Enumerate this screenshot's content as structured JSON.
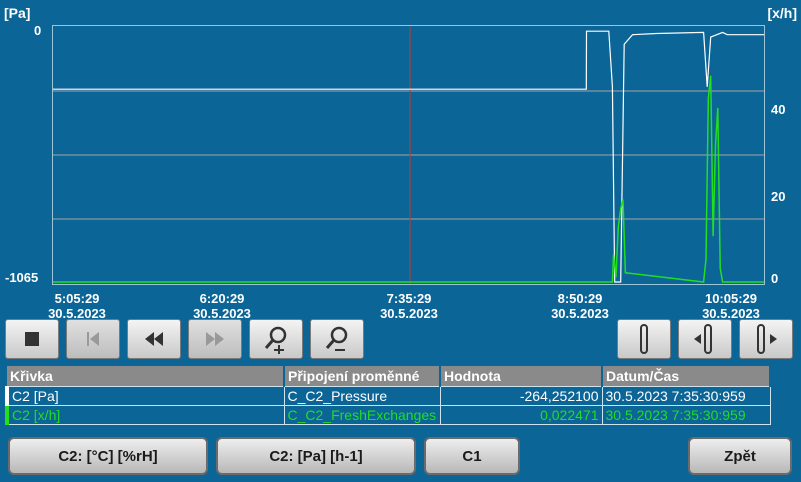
{
  "units": {
    "left": "[Pa]",
    "right": "[x/h]"
  },
  "y_left_ticks": [
    "0",
    "-1065"
  ],
  "y_right_ticks": [
    "40",
    "20",
    "0"
  ],
  "x_ticks": [
    {
      "time": "5:05:29",
      "date": "30.5.2023"
    },
    {
      "time": "6:20:29",
      "date": "30.5.2023"
    },
    {
      "time": "7:35:29",
      "date": "30.5.2023"
    },
    {
      "time": "8:50:29",
      "date": "30.5.2023"
    },
    {
      "time": "10:05:29",
      "date": "30.5.2023"
    }
  ],
  "colors": {
    "background": "#0b6597",
    "pressure_series": "#ffffff",
    "exchange_series": "#22dd22",
    "cursor": "#c0392b"
  },
  "toolbar": {
    "left_icons": [
      "stop-icon",
      "skip-start-icon",
      "rewind-icon",
      "forward-icon",
      "zoom-in-icon",
      "zoom-out-icon"
    ],
    "right_icons": [
      "ruler-icon",
      "ruler-left-icon",
      "ruler-right-icon"
    ]
  },
  "table": {
    "headers": [
      "Křivka",
      "Připojení proměnné",
      "Hodnota",
      "Datum/Čas"
    ],
    "rows": [
      {
        "curve": "C2 [Pa]",
        "variable": "C_C2_Pressure",
        "value": "-264,252100",
        "datetime": "30.5.2023 7:35:30:959"
      },
      {
        "curve": "C2 [x/h]",
        "variable": "C_C2_FreshExchanges",
        "value": "0,022471",
        "datetime": "30.5.2023 7:35:30:959"
      }
    ]
  },
  "buttons": {
    "b1": "C2: [°C] [%rH]",
    "b2": "C2: [Pa] [h-1]",
    "b3": "C1",
    "back": "Zpět"
  },
  "chart_data": {
    "type": "line",
    "x_range": [
      "5:05:29",
      "10:05:29"
    ],
    "ylim_left": [
      -1065,
      0
    ],
    "ylim_right": [
      0,
      55
    ],
    "series": [
      {
        "axis": "left",
        "color": "#ffffff",
        "points": [
          [
            "5:05:29",
            -250
          ],
          [
            "8:50:29",
            -250
          ],
          [
            "8:50:35",
            -5
          ],
          [
            "9:00:00",
            -5
          ],
          [
            "9:01:30",
            -240
          ],
          [
            "9:02:30",
            -1065
          ],
          [
            "9:05:00",
            -1065
          ],
          [
            "9:06:30",
            -60
          ],
          [
            "9:10:00",
            -20
          ],
          [
            "9:20:00",
            -15
          ],
          [
            "9:40:00",
            -10
          ],
          [
            "9:41:30",
            -240
          ],
          [
            "9:43:00",
            -30
          ],
          [
            "9:48:00",
            -10
          ],
          [
            "9:50:00",
            -20
          ],
          [
            "10:05:29",
            -20
          ]
        ]
      },
      {
        "axis": "right",
        "color": "#22dd22",
        "points": [
          [
            "5:05:29",
            0
          ],
          [
            "9:01:30",
            0
          ],
          [
            "9:02:00",
            6
          ],
          [
            "9:03:00",
            1
          ],
          [
            "9:04:00",
            12
          ],
          [
            "9:05:00",
            16
          ],
          [
            "9:06:00",
            18
          ],
          [
            "9:07:00",
            2
          ],
          [
            "9:40:00",
            0
          ],
          [
            "9:41:00",
            5
          ],
          [
            "9:42:00",
            40
          ],
          [
            "9:43:00",
            45
          ],
          [
            "9:44:00",
            10
          ],
          [
            "9:45:00",
            30
          ],
          [
            "9:46:00",
            38
          ],
          [
            "9:47:00",
            3
          ],
          [
            "9:48:00",
            0
          ],
          [
            "10:05:29",
            0
          ]
        ]
      }
    ]
  }
}
